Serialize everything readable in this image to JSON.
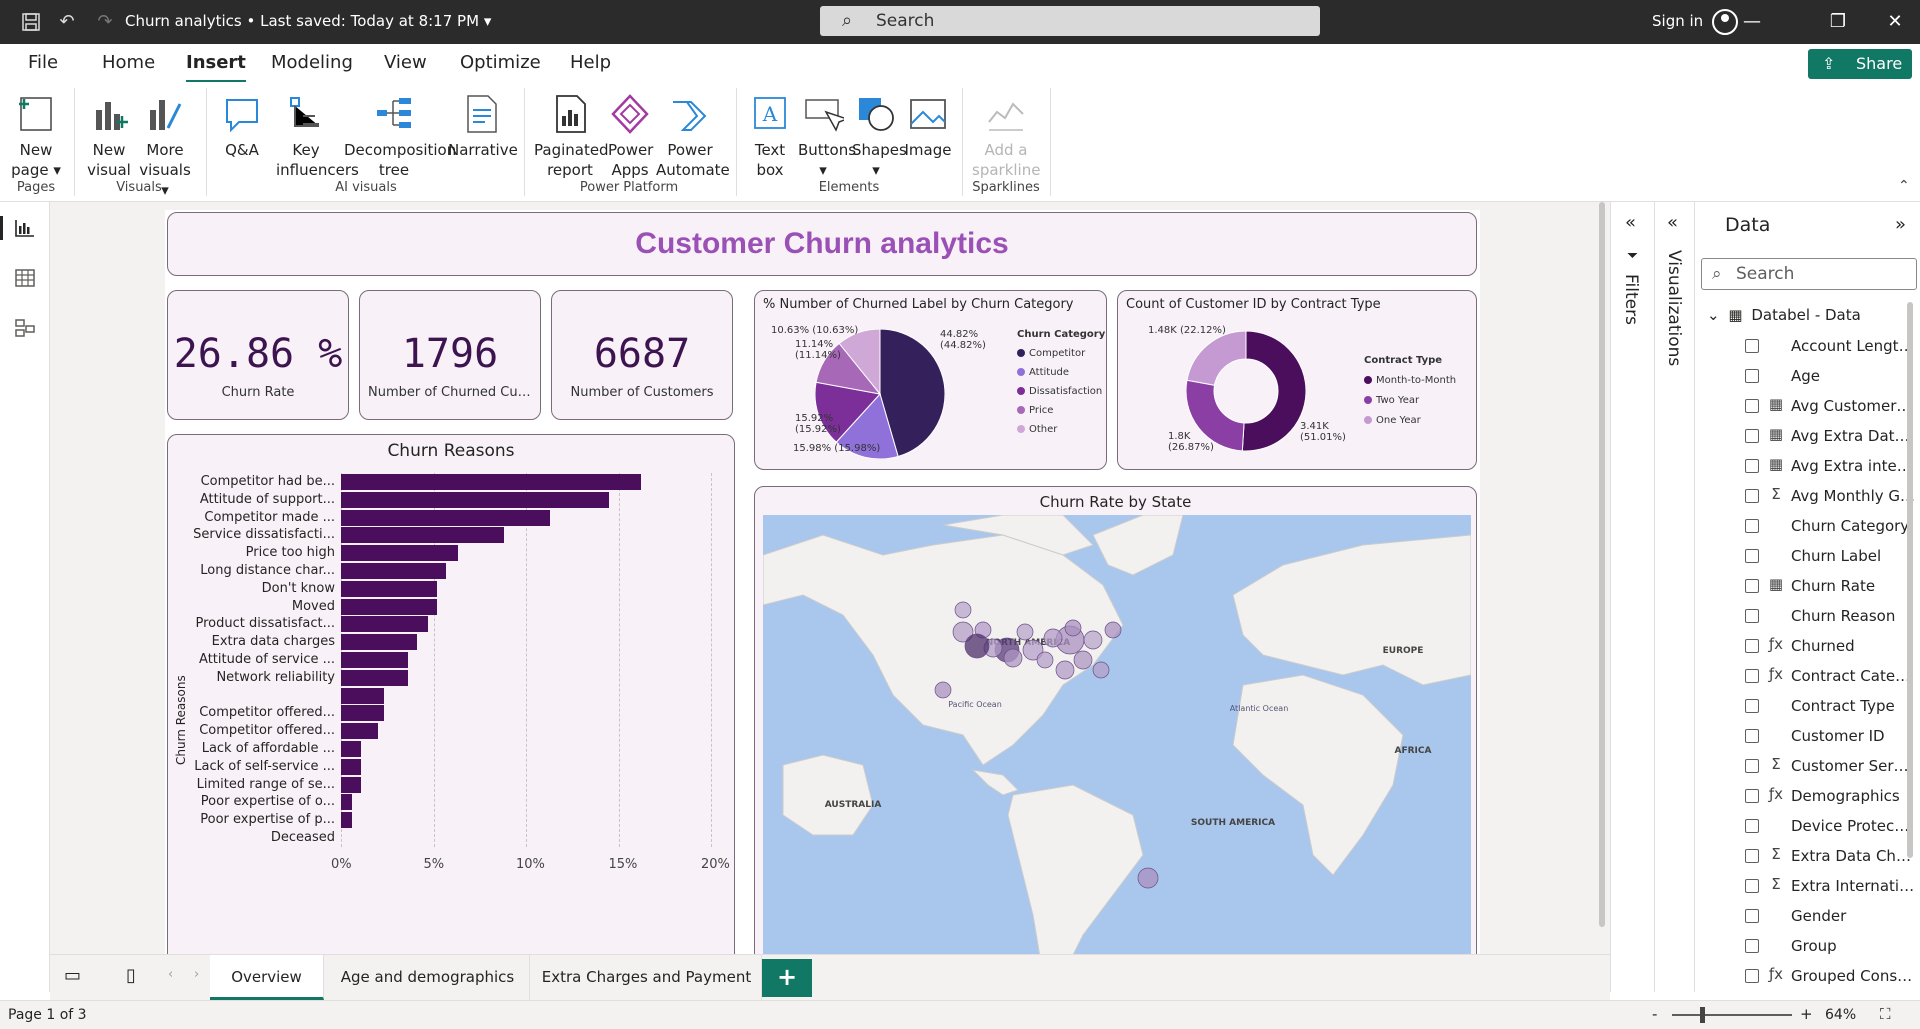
{
  "app": {
    "title": "Churn analytics",
    "saved": "Last saved: Today at 8:17 PM",
    "search_placeholder": "Search",
    "sign_in": "Sign in",
    "share": "Share"
  },
  "menu": {
    "tabs": [
      "File",
      "Home",
      "Insert",
      "Modeling",
      "View",
      "Optimize",
      "Help"
    ],
    "active": "Insert"
  },
  "ribbon": {
    "buttons": [
      {
        "label": "New page",
        "group": "Pages"
      },
      {
        "label": "New visual",
        "group": "Visuals"
      },
      {
        "label": "More visuals",
        "group": "Visuals"
      },
      {
        "label": "Q&A",
        "group": "AI visuals"
      },
      {
        "label": "Key influencers",
        "group": "AI visuals"
      },
      {
        "label": "Decomposition tree",
        "group": "AI visuals"
      },
      {
        "label": "Narrative",
        "group": "AI visuals"
      },
      {
        "label": "Paginated report",
        "group": "Power Platform"
      },
      {
        "label": "Power Apps",
        "group": "Power Platform"
      },
      {
        "label": "Power Automate",
        "group": "Power Platform"
      },
      {
        "label": "Text box",
        "group": "Elements"
      },
      {
        "label": "Buttons",
        "group": "Elements"
      },
      {
        "label": "Shapes",
        "group": "Elements"
      },
      {
        "label": "Image",
        "group": "Elements"
      },
      {
        "label": "Add a sparkline",
        "group": "Sparklines"
      }
    ],
    "groups": [
      "Pages",
      "Visuals",
      "AI visuals",
      "Power Platform",
      "Elements",
      "Sparklines"
    ]
  },
  "report": {
    "title": "Customer Churn analytics",
    "kpis": [
      {
        "value": "26.86 %",
        "label": "Churn Rate"
      },
      {
        "value": "1796",
        "label": "Number of Churned Customers"
      },
      {
        "value": "6687",
        "label": "Number of Customers"
      }
    ],
    "map_title": "Churn Rate by State",
    "map_labels": {
      "north_america": "NORTH AMERICA",
      "south_america": "SOUTH AMERICA",
      "europe": "EUROPE",
      "africa": "AFRICA",
      "australia": "AUSTRALIA",
      "pacific": "Pacific Ocean",
      "atlantic": "Atlantic Ocean"
    }
  },
  "chart_data": [
    {
      "type": "pie",
      "title": "% Number of Churned Label by Churn Category",
      "legend_title": "Churn Category",
      "categories": [
        "Competitor",
        "Attitude",
        "Dissatisfaction",
        "Price",
        "Other"
      ],
      "values": [
        44.82,
        15.98,
        15.92,
        11.14,
        10.63
      ],
      "data_labels": [
        "44.82% (44.82%)",
        "15.98% (15.98%)",
        "15.92% (15.92%)",
        "11.14% (11.14%)",
        "10.63% (10.63%)"
      ],
      "colors": [
        "#34215c",
        "#9071d9",
        "#7c2f98",
        "#a768b7",
        "#cfa8d8"
      ],
      "legend": "right"
    },
    {
      "type": "pie",
      "title": "Count of Customer ID by Contract Type",
      "legend_title": "Contract Type",
      "categories": [
        "Month-to-Month",
        "Two Year",
        "One Year"
      ],
      "values": [
        3410,
        1800,
        1480
      ],
      "data_labels": [
        "3.41K (51.01%)",
        "1.8K (26.87%)",
        "1.48K (22.12%)"
      ],
      "colors": [
        "#4b0e5c",
        "#8b3fa5",
        "#c59ad2"
      ],
      "legend": "right"
    },
    {
      "type": "bar",
      "orientation": "horizontal",
      "title": "Churn Reasons",
      "ylabel": "Churn Reasons",
      "categories": [
        "Competitor had be...",
        "Attitude of support...",
        "Competitor made ...",
        "Service dissatisfacti...",
        "Price too high",
        "Long distance char...",
        "Don't know",
        "Moved",
        "Product dissatisfact...",
        "Extra data charges",
        "Attitude of service ...",
        "Network reliability",
        "",
        "Competitor offered...",
        "Competitor offered...",
        "Lack of affordable ...",
        "Lack of self-service ...",
        "Limited range of se...",
        "Poor expertise of o...",
        "Poor expertise of p...",
        "Deceased"
      ],
      "values": [
        16.2,
        14.5,
        11.3,
        8.8,
        6.3,
        5.7,
        5.2,
        5.2,
        4.7,
        4.1,
        3.6,
        3.6,
        2.3,
        2.3,
        2.0,
        1.1,
        1.1,
        1.1,
        0.6,
        0.6,
        0
      ],
      "xticks": [
        "0%",
        "5%",
        "10%",
        "15%",
        "20%"
      ],
      "xlim": [
        0,
        20
      ],
      "grid": true,
      "color": "#4b0e5c"
    }
  ],
  "panes": {
    "filters": "Filters",
    "visualizations": "Visualizations",
    "data_title": "Data",
    "data_search": "Search",
    "table": "Databel - Data"
  },
  "fields": [
    {
      "name": "Account Length (in months)",
      "icon": ""
    },
    {
      "name": "Age",
      "icon": ""
    },
    {
      "name": "Avg Customer Service Calls",
      "icon": "calc"
    },
    {
      "name": "Avg Extra Data Charges",
      "icon": "calc"
    },
    {
      "name": "Avg Extra international Charges",
      "icon": "calc"
    },
    {
      "name": "Avg Monthly GB Download",
      "icon": "sigma"
    },
    {
      "name": "Churn Category",
      "icon": ""
    },
    {
      "name": "Churn Label",
      "icon": ""
    },
    {
      "name": "Churn Rate",
      "icon": "calc"
    },
    {
      "name": "Churn Reason",
      "icon": ""
    },
    {
      "name": "Churned",
      "icon": "fx"
    },
    {
      "name": "Contract Category",
      "icon": "fx"
    },
    {
      "name": "Contract Type",
      "icon": ""
    },
    {
      "name": "Customer ID",
      "icon": ""
    },
    {
      "name": "Customer Service Calls",
      "icon": "sigma"
    },
    {
      "name": "Demographics",
      "icon": "fx"
    },
    {
      "name": "Device Protection & Online Backup",
      "icon": ""
    },
    {
      "name": "Extra Data Charges",
      "icon": "sigma"
    },
    {
      "name": "Extra International Charges",
      "icon": "sigma"
    },
    {
      "name": "Gender",
      "icon": ""
    },
    {
      "name": "Group",
      "icon": ""
    },
    {
      "name": "Grouped Consumption",
      "icon": "fx"
    }
  ],
  "pages": {
    "tabs": [
      "Overview",
      "Age and demographics",
      "Extra Charges and Payment"
    ],
    "active": "Overview",
    "add": "+"
  },
  "status": {
    "page": "Page 1 of 3",
    "zoom": "64%",
    "minus": "-",
    "plus": "+"
  }
}
